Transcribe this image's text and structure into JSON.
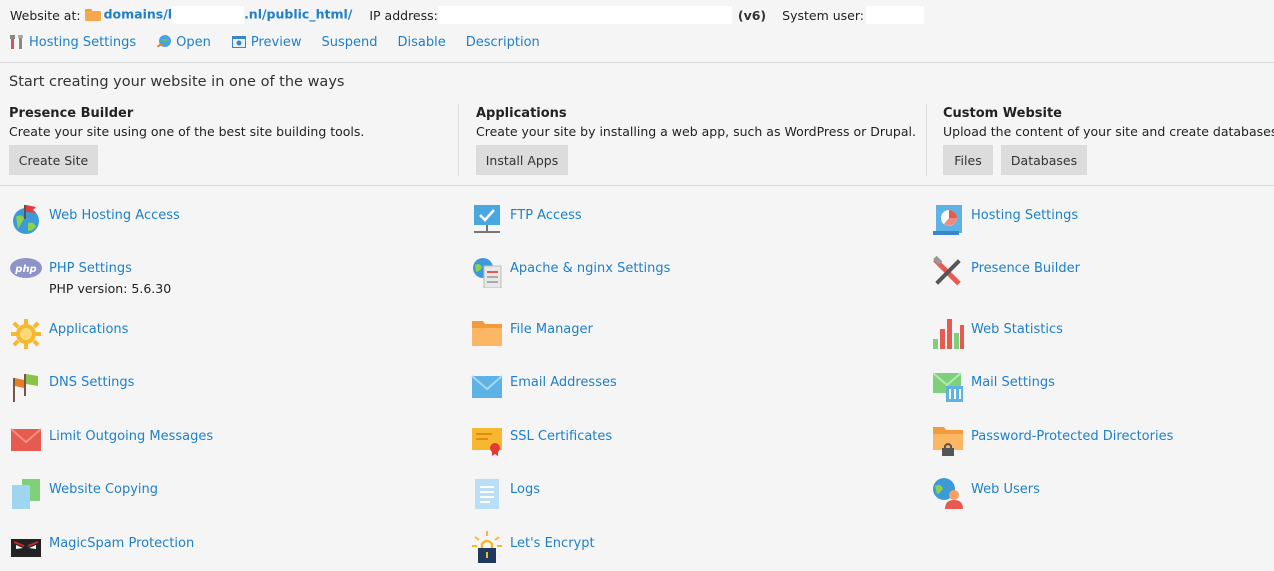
{
  "info": {
    "website_label": "Website at:",
    "path_part1": "domains/l",
    "path_part2": ".nl/public_html/",
    "ip_label": "IP address:",
    "ipv6_tag": "(v6)",
    "system_user_label": "System user:"
  },
  "toolbar": {
    "hosting_settings": "Hosting Settings",
    "open": "Open",
    "preview": "Preview",
    "suspend": "Suspend",
    "disable": "Disable",
    "description": "Description"
  },
  "start": {
    "heading": "Start creating your website in one of the ways",
    "columns": [
      {
        "title": "Presence Builder",
        "desc": "Create your site using one of the best site building tools.",
        "buttons": [
          "Create Site"
        ]
      },
      {
        "title": "Applications",
        "desc": "Create your site by installing a web app, such as WordPress or Drupal.",
        "buttons": [
          "Install Apps"
        ]
      },
      {
        "title": "Custom Website",
        "desc": "Upload the content of your site and create databases.",
        "buttons": [
          "Files",
          "Databases"
        ]
      }
    ]
  },
  "tools": {
    "col1": [
      {
        "name": "Web Hosting Access",
        "icon": "globe-flag-icon"
      },
      {
        "name": "PHP Settings",
        "sub": "PHP version: 5.6.30",
        "icon": "php-icon"
      },
      {
        "name": "Applications",
        "icon": "gear-sun-icon"
      },
      {
        "name": "DNS Settings",
        "icon": "dns-flags-icon"
      },
      {
        "name": "Limit Outgoing Messages",
        "icon": "red-envelope-icon"
      },
      {
        "name": "Website Copying",
        "icon": "copy-pages-icon"
      },
      {
        "name": "MagicSpam Protection",
        "icon": "magicspam-icon"
      }
    ],
    "col2": [
      {
        "name": "FTP Access",
        "icon": "ftp-icon"
      },
      {
        "name": "Apache & nginx Settings",
        "icon": "apache-icon"
      },
      {
        "name": "File Manager",
        "icon": "folder-icon"
      },
      {
        "name": "Email Addresses",
        "icon": "envelope-icon"
      },
      {
        "name": "SSL Certificates",
        "icon": "certificate-icon"
      },
      {
        "name": "Logs",
        "icon": "logs-icon"
      },
      {
        "name": "Let's Encrypt",
        "icon": "lock-sun-icon"
      }
    ],
    "col3": [
      {
        "name": "Hosting Settings",
        "icon": "hosting-settings-icon"
      },
      {
        "name": "Presence Builder",
        "icon": "tools-icon"
      },
      {
        "name": "Web Statistics",
        "icon": "bar-chart-icon"
      },
      {
        "name": "Mail Settings",
        "icon": "mail-settings-icon"
      },
      {
        "name": "Password-Protected Directories",
        "icon": "locked-folder-icon"
      },
      {
        "name": "Web Users",
        "icon": "web-user-icon"
      }
    ]
  },
  "colors": {
    "link": "#1f80c8",
    "button": "#dcdcdc",
    "background": "#f5f5f5"
  }
}
